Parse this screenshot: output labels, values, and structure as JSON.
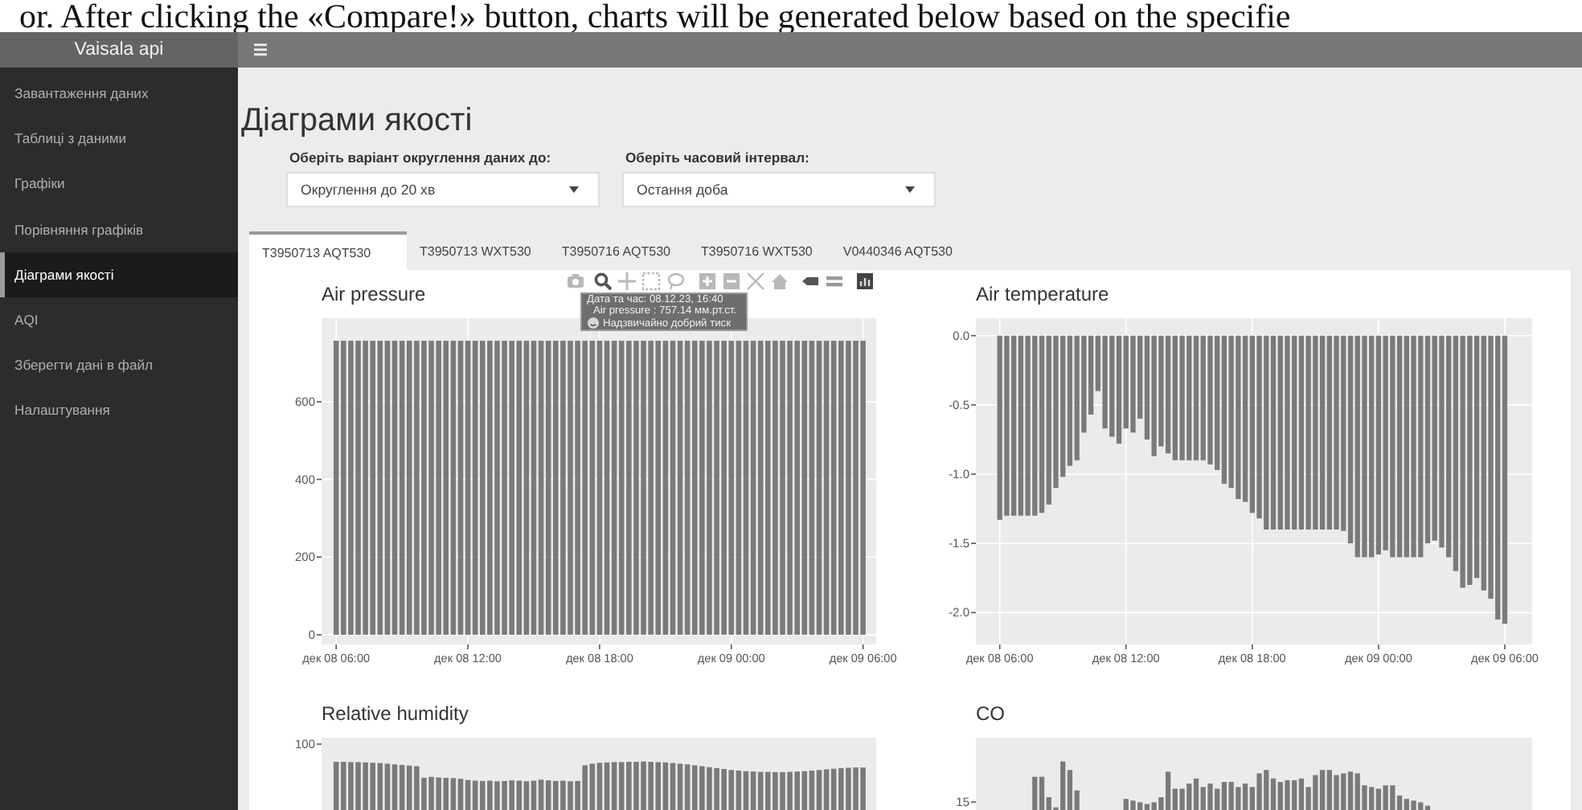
{
  "caption": "or. After clicking the «Compare!» button, charts will be generated below based on the specifie",
  "header": {
    "title": "Vaisala api"
  },
  "sidebar": {
    "items": [
      {
        "label": "Завантаження даних",
        "selected": false
      },
      {
        "label": "Таблиці з даними",
        "selected": false
      },
      {
        "label": "Графіки",
        "selected": false
      },
      {
        "label": "Порівняння графіків",
        "selected": false
      },
      {
        "label": "Діаграми якості",
        "selected": true
      },
      {
        "label": "AQI",
        "selected": false
      },
      {
        "label": "Зберегти дані в файл",
        "selected": false
      },
      {
        "label": "Налаштування",
        "selected": false
      }
    ]
  },
  "page_title": "Діаграми якості",
  "filters": [
    {
      "label": "Оберіть варіант округлення даних до:",
      "value": "Округлення до 20 хв"
    },
    {
      "label": "Оберіть часовий інтервал:",
      "value": "Остання доба"
    }
  ],
  "tabs": [
    {
      "label": "T3950713 AQT530",
      "selected": true
    },
    {
      "label": "T3950713 WXT530",
      "selected": false
    },
    {
      "label": "T3950716 AQT530",
      "selected": false
    },
    {
      "label": "T3950716 WXT530",
      "selected": false
    },
    {
      "label": "V0440346 AQT530",
      "selected": false
    }
  ],
  "plots": [
    {
      "modebar": true,
      "tooltip": {
        "lines": [
          "Дата та час: 08.12.23, 16:40",
          "Air pressure : 757.14 мм.рт.ст.",
          "Надзвичайно добрий тиск"
        ]
      },
      "chart_data": {
        "type": "bar",
        "title": "Air pressure",
        "grid": true,
        "ylim": [
          -25,
          815
        ],
        "yticks": [
          0,
          200,
          400,
          600
        ],
        "categories": [
          "дек 08 06:00",
          null,
          null,
          null,
          null,
          null,
          null,
          null,
          null,
          null,
          null,
          null,
          null,
          null,
          null,
          null,
          null,
          null,
          "дек 08 12:00",
          null,
          null,
          null,
          null,
          null,
          null,
          null,
          null,
          null,
          null,
          null,
          null,
          null,
          null,
          null,
          null,
          null,
          "дек 08 18:00",
          null,
          null,
          null,
          null,
          null,
          null,
          null,
          null,
          null,
          null,
          null,
          null,
          null,
          null,
          null,
          null,
          null,
          "дек 09 00:00",
          null,
          null,
          null,
          null,
          null,
          null,
          null,
          null,
          null,
          null,
          null,
          null,
          null,
          null,
          null,
          null,
          null,
          "дек 09 06:00"
        ],
        "values": [
          757,
          757,
          757,
          757,
          757,
          757,
          757,
          757,
          757,
          757,
          757,
          757,
          757,
          757,
          757,
          757,
          757,
          757,
          757,
          757,
          757,
          757,
          757,
          757,
          757,
          757,
          757,
          757,
          757,
          757,
          757,
          757,
          757,
          757,
          757,
          757,
          757,
          757,
          757,
          757,
          757,
          757,
          757,
          757,
          757,
          757,
          757,
          757,
          757,
          757,
          757,
          757,
          757,
          757,
          757,
          757,
          757,
          757,
          757,
          757,
          757,
          757,
          757,
          757,
          757,
          757,
          757,
          757,
          757,
          757,
          757,
          757,
          757
        ]
      }
    },
    {
      "chart_data": {
        "type": "bar",
        "title": "Air temperature",
        "grid": true,
        "ylim": [
          -2.23,
          0.126
        ],
        "yticks": [
          {
            "value": 0,
            "label": "0.0"
          },
          {
            "value": -0.5,
            "label": "-0.5"
          },
          {
            "value": -1,
            "label": "-1.0"
          },
          {
            "value": -1.5,
            "label": "-1.5"
          },
          {
            "value": -2,
            "label": "-2.0"
          }
        ],
        "categories": [
          "дек 08 06:00",
          null,
          null,
          null,
          null,
          null,
          null,
          null,
          null,
          null,
          null,
          null,
          null,
          null,
          null,
          null,
          null,
          null,
          "дек 08 12:00",
          null,
          null,
          null,
          null,
          null,
          null,
          null,
          null,
          null,
          null,
          null,
          null,
          null,
          null,
          null,
          null,
          null,
          "дек 08 18:00",
          null,
          null,
          null,
          null,
          null,
          null,
          null,
          null,
          null,
          null,
          null,
          null,
          null,
          null,
          null,
          null,
          null,
          "дек 09 00:00",
          null,
          null,
          null,
          null,
          null,
          null,
          null,
          null,
          null,
          null,
          null,
          null,
          null,
          null,
          null,
          null,
          null,
          "дек 09 06:00"
        ],
        "values": [
          -1.33,
          -1.3,
          -1.3,
          -1.3,
          -1.3,
          -1.3,
          -1.28,
          -1.22,
          -1.1,
          -1.02,
          -0.94,
          -0.9,
          -0.7,
          -0.57,
          -0.4,
          -0.67,
          -0.73,
          -0.78,
          -0.67,
          -0.7,
          -0.6,
          -0.75,
          -0.87,
          -0.8,
          -0.85,
          -0.9,
          -0.9,
          -0.9,
          -0.9,
          -0.9,
          -0.93,
          -0.97,
          -1.07,
          -1.1,
          -1.18,
          -1.2,
          -1.28,
          -1.32,
          -1.4,
          -1.4,
          -1.4,
          -1.4,
          -1.4,
          -1.4,
          -1.4,
          -1.4,
          -1.4,
          -1.4,
          -1.4,
          -1.41,
          -1.5,
          -1.6,
          -1.6,
          -1.6,
          -1.58,
          -1.55,
          -1.6,
          -1.6,
          -1.6,
          -1.6,
          -1.6,
          -1.5,
          -1.48,
          -1.53,
          -1.6,
          -1.7,
          -1.82,
          -1.8,
          -1.75,
          -1.84,
          -1.9,
          -2.05,
          -2.08
        ]
      }
    },
    {
      "title": "Relative humidity",
      "tick_label": "100",
      "kind": "humidity"
    },
    {
      "title": "CO",
      "tick_label": "15",
      "kind": "co"
    }
  ]
}
